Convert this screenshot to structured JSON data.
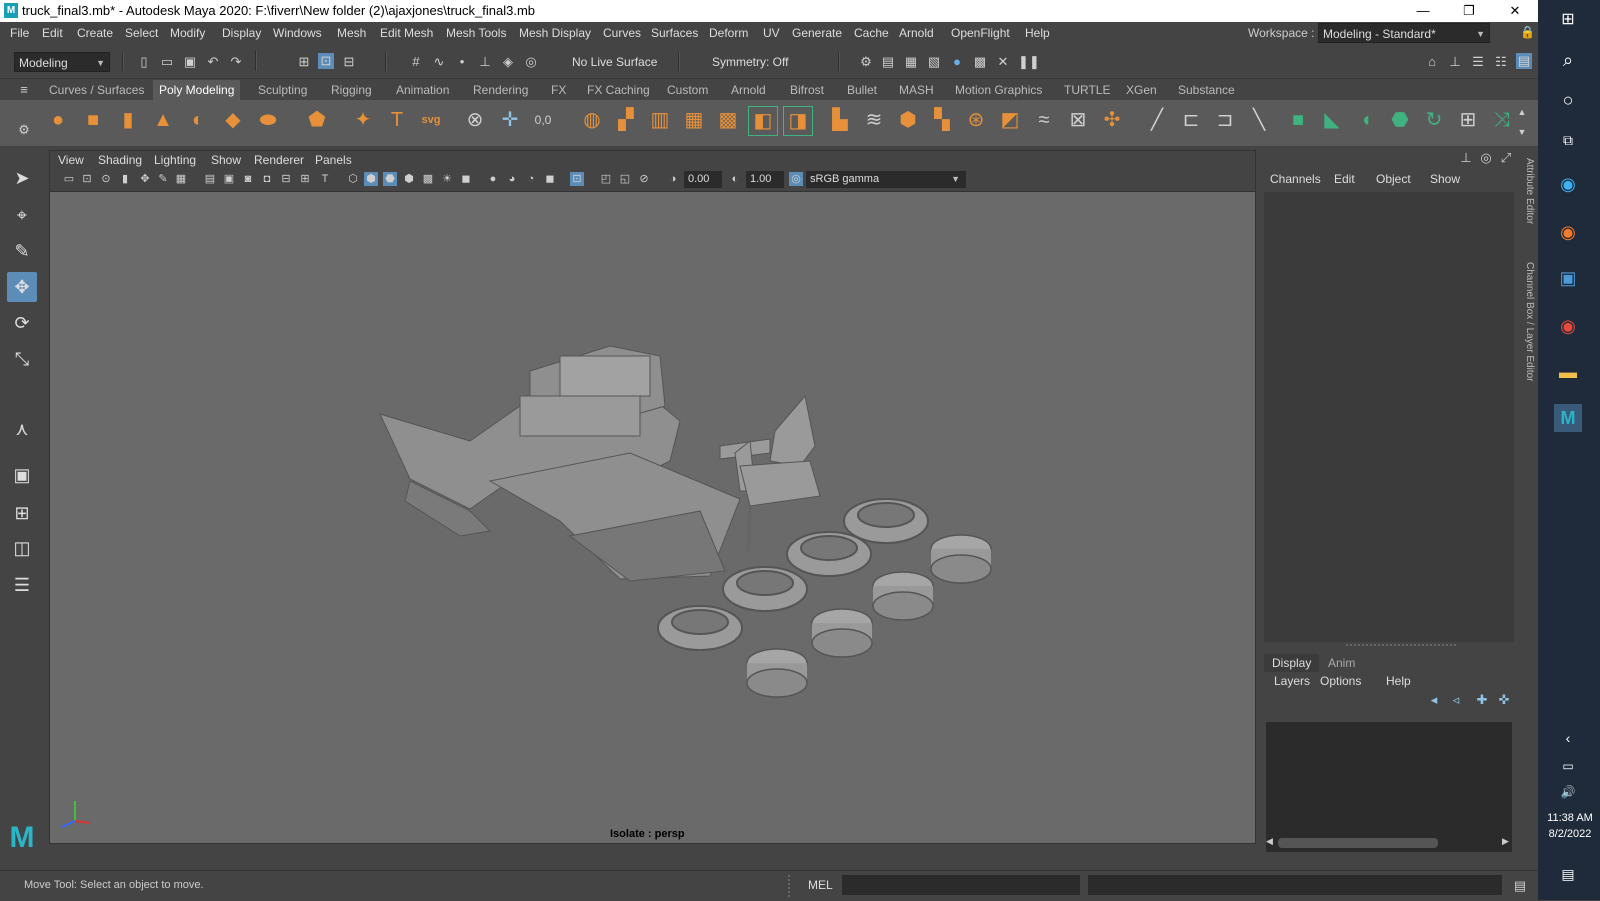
{
  "window": {
    "title": "truck_final3.mb* - Autodesk Maya 2020: F:\\fiverr\\New folder (2)\\ajaxjones\\truck_final3.mb",
    "logo": "M",
    "minimize": "—",
    "restore": "❐",
    "close": "✕"
  },
  "menubar": {
    "items": [
      "File",
      "Edit",
      "Create",
      "Select",
      "Modify",
      "Display",
      "Windows",
      "Mesh",
      "Edit Mesh",
      "Mesh Tools",
      "Mesh Display",
      "Curves",
      "Surfaces",
      "Deform",
      "UV",
      "Generate",
      "Cache",
      "Arnold",
      "OpenFlight",
      "Help"
    ],
    "workspace_label": "Workspace :",
    "workspace_value": "Modeling - Standard*"
  },
  "statusline": {
    "menuset": "Modeling",
    "live_surface": "No Live Surface",
    "symmetry": "Symmetry: Off"
  },
  "shelf_tabs": [
    "Curves / Surfaces",
    "Poly Modeling",
    "Sculpting",
    "Rigging",
    "Animation",
    "Rendering",
    "FX",
    "FX Caching",
    "Custom",
    "Arnold",
    "Bifrost",
    "Bullet",
    "MASH",
    "Motion Graphics",
    "TURTLE",
    "XGen",
    "Substance"
  ],
  "shelf_active": "Poly Modeling",
  "viewport": {
    "menus": [
      "View",
      "Shading",
      "Lighting",
      "Show",
      "Renderer",
      "Panels"
    ],
    "exposure": "0.00",
    "gamma": "1.00",
    "color_space": "sRGB gamma",
    "isolate_label": "Isolate : persp"
  },
  "channelbox": {
    "menus": [
      "Channels",
      "Edit",
      "Object",
      "Show"
    ],
    "layer_tabs": [
      "Display",
      "Anim"
    ],
    "layer_menus": [
      "Layers",
      "Options",
      "Help"
    ]
  },
  "side_labels": {
    "attribute_editor": "Attribute Editor",
    "channel_box": "Channel Box / Layer Editor"
  },
  "helpline": {
    "message": "Move Tool: Select an object to move.",
    "script_lang": "MEL"
  },
  "taskbar": {
    "time": "11:38 AM",
    "date": "8/2/2022"
  }
}
